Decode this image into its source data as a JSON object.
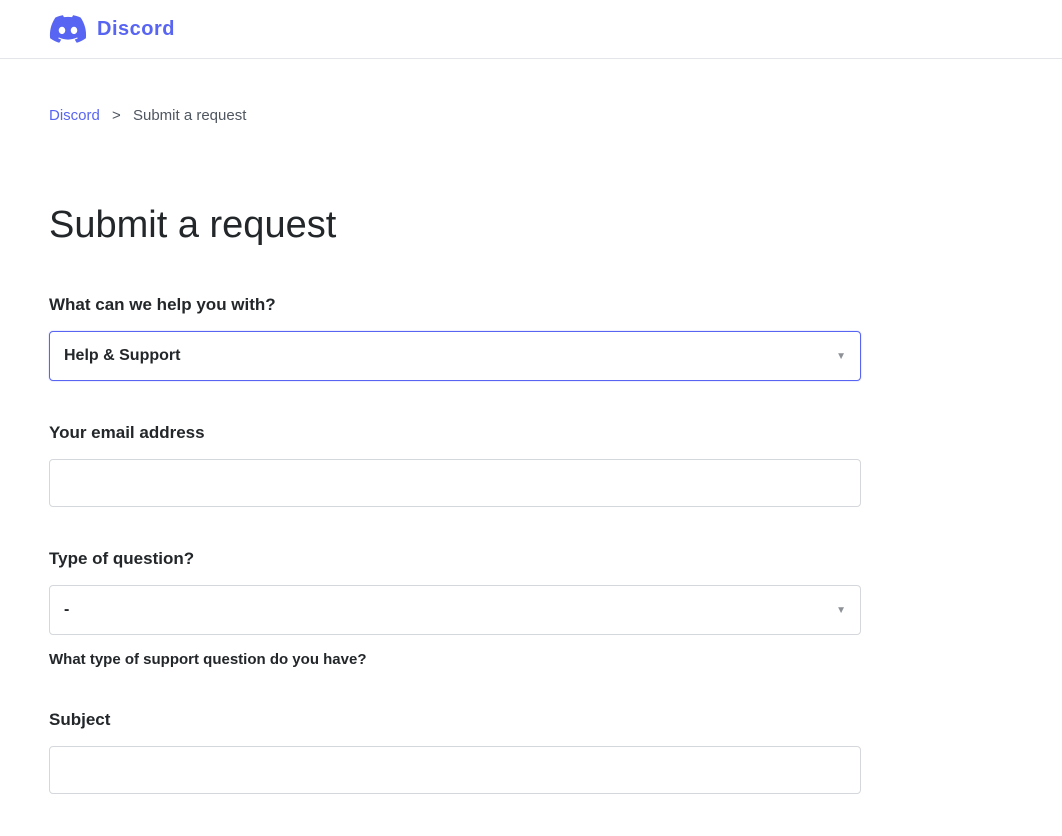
{
  "header": {
    "brand_name": "Discord"
  },
  "breadcrumb": {
    "home_label": "Discord",
    "separator": ">",
    "current": "Submit a request"
  },
  "page": {
    "title": "Submit a request"
  },
  "form": {
    "help_category": {
      "label": "What can we help you with?",
      "selected": "Help & Support"
    },
    "email": {
      "label": "Your email address",
      "value": ""
    },
    "question_type": {
      "label": "Type of question?",
      "selected": "-",
      "help_text": "What type of support question do you have?"
    },
    "subject": {
      "label": "Subject",
      "value": ""
    }
  }
}
